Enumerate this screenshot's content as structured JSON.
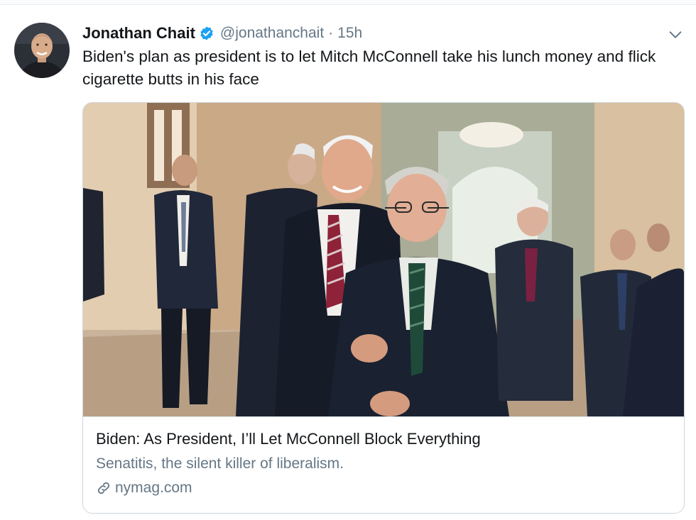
{
  "tweet": {
    "author_name": "Jonathan Chait",
    "handle": "@jonathanchait",
    "separator": "·",
    "time": "15h",
    "text": "Biden's plan as president is to let Mitch McConnell take his lunch money and flick cigarette butts in his face",
    "verified": true
  },
  "card": {
    "title": "Biden: As President, I’ll Let McConnell Block Everything",
    "description": "Senatitis, the silent killer of liberalism.",
    "domain": "nymag.com"
  },
  "icons": {
    "verified": "verified-badge-icon",
    "caret": "chevron-down-icon",
    "link": "link-icon"
  },
  "colors": {
    "text_primary": "#14171a",
    "text_secondary": "#657786",
    "verified_blue": "#1da1f2",
    "border": "#ccd6dd"
  }
}
